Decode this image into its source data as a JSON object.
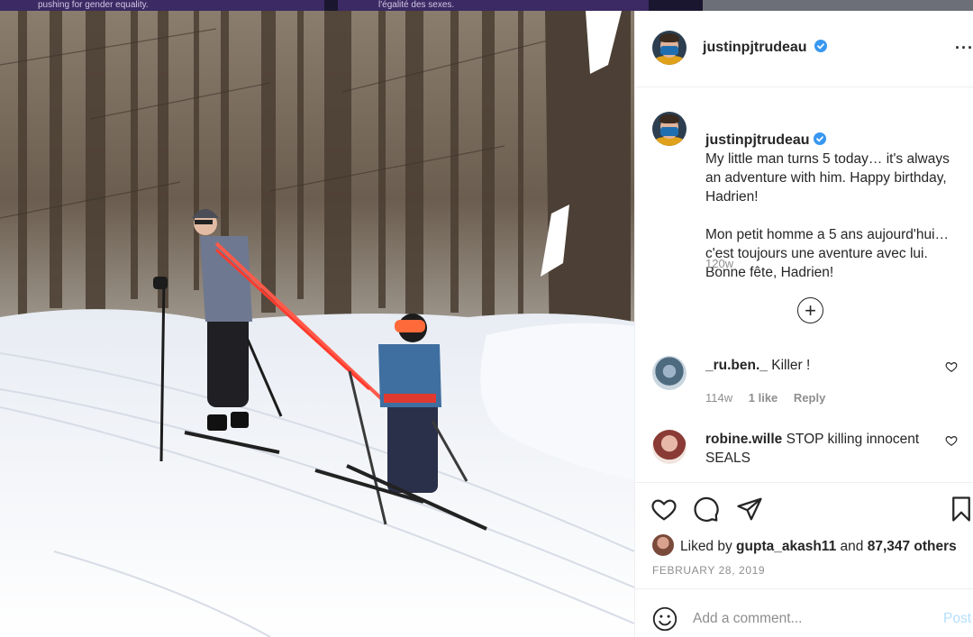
{
  "top_strip": {
    "left_text": "pushing for gender equality.",
    "right_text": "l'égalité des sexes."
  },
  "photo": {
    "icon": "photo-skiing",
    "description_colors": {
      "snow": "#f4f6fa",
      "trees": "#5a4a3c",
      "rope": "#ff5a4a"
    }
  },
  "post": {
    "author": "justinpjtrudeau",
    "verified": true,
    "caption_paragraphs": [
      "My little man turns 5 today… it's always an adventure with him. Happy birthday, Hadrien!",
      "Mon petit homme a 5 ans aujourd'hui… c'est toujours une aventure avec lui. Bonne fête, Hadrien!"
    ],
    "time_ago": "120w",
    "comments": [
      {
        "user": "_ru.ben._",
        "text": "Killer !",
        "time": "114w",
        "likes": "1 like",
        "reply": "Reply"
      },
      {
        "user": "robine.wille",
        "text": "STOP killing innocent SEALS"
      }
    ],
    "liked_by_prefix": "Liked by",
    "liked_by_user": "gupta_akash11",
    "liked_by_and": "and",
    "liked_by_count": "87,347 others",
    "date": "FEBRUARY 28, 2019",
    "add_comment_placeholder": "Add a comment...",
    "post_label": "Post"
  },
  "colors": {
    "accent_blue": "#0095f6",
    "post_disabled": "#b3dffc",
    "text_primary": "#262626",
    "text_secondary": "#8e8e8e"
  }
}
